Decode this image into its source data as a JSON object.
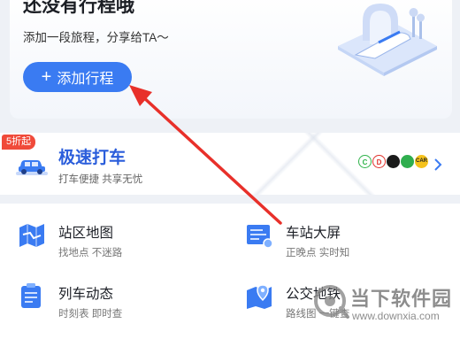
{
  "trip_card": {
    "title": "还没有行程哦",
    "subtitle": "添加一段旅程，分享给TA～",
    "add_button_icon": "+",
    "add_button_label": "添加行程"
  },
  "taxi": {
    "badge": "5折起",
    "title": "极速打车",
    "subtitle": "打车便捷 共享无忧",
    "partners": [
      "C",
      "D",
      "",
      "",
      "CAR"
    ]
  },
  "services": [
    {
      "title": "站区地图",
      "subtitle": "找地点 不迷路",
      "icon": "map-icon"
    },
    {
      "title": "车站大屏",
      "subtitle": "正晚点 实时知",
      "icon": "station-screen-icon"
    },
    {
      "title": "列车动态",
      "subtitle": "时刻表 即时查",
      "icon": "train-status-icon"
    },
    {
      "title": "公交地铁",
      "subtitle": "路线图 一键查",
      "icon": "bus-metro-icon"
    }
  ],
  "watermark": {
    "name": "当下软件园",
    "url": "www.downxia.com"
  },
  "colors": {
    "accent": "#3a7bf2",
    "taxi_title": "#2a5ddb",
    "badge": "#f04a3a",
    "arrow": "#e8302a"
  }
}
